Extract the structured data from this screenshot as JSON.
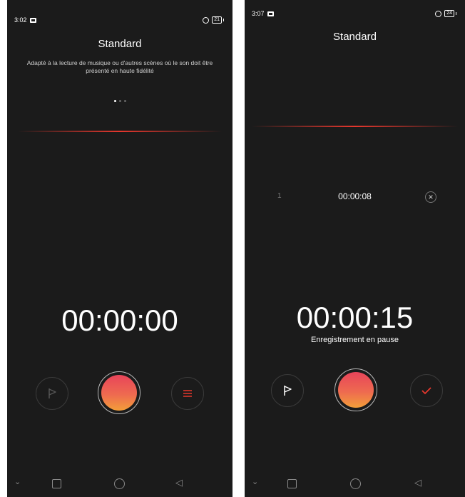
{
  "left": {
    "status": {
      "time": "3:02",
      "battery": "21"
    },
    "title": "Standard",
    "subtitle": "Adapté à la lecture de musique ou d'autres scènes où le son doit être présenté en haute fidélité",
    "timer": "00:00:00"
  },
  "right": {
    "status": {
      "time": "3:07",
      "battery": "24"
    },
    "title": "Standard",
    "mark": {
      "index": "1",
      "time": "00:00:08"
    },
    "timer": "00:00:15",
    "state_label": "Enregistrement en pause"
  },
  "colors": {
    "background": "#1b1b1b",
    "record_gradient_top": "#e8445a",
    "record_gradient_bottom": "#f39e3a",
    "accent_red": "#e6372d"
  },
  "icons": [
    "notification-icon",
    "alarm-icon",
    "battery-icon",
    "flag-icon",
    "menu-icon",
    "check-icon",
    "close-icon",
    "nav-chevron-icon",
    "nav-recents-icon",
    "nav-home-icon",
    "nav-back-icon"
  ]
}
